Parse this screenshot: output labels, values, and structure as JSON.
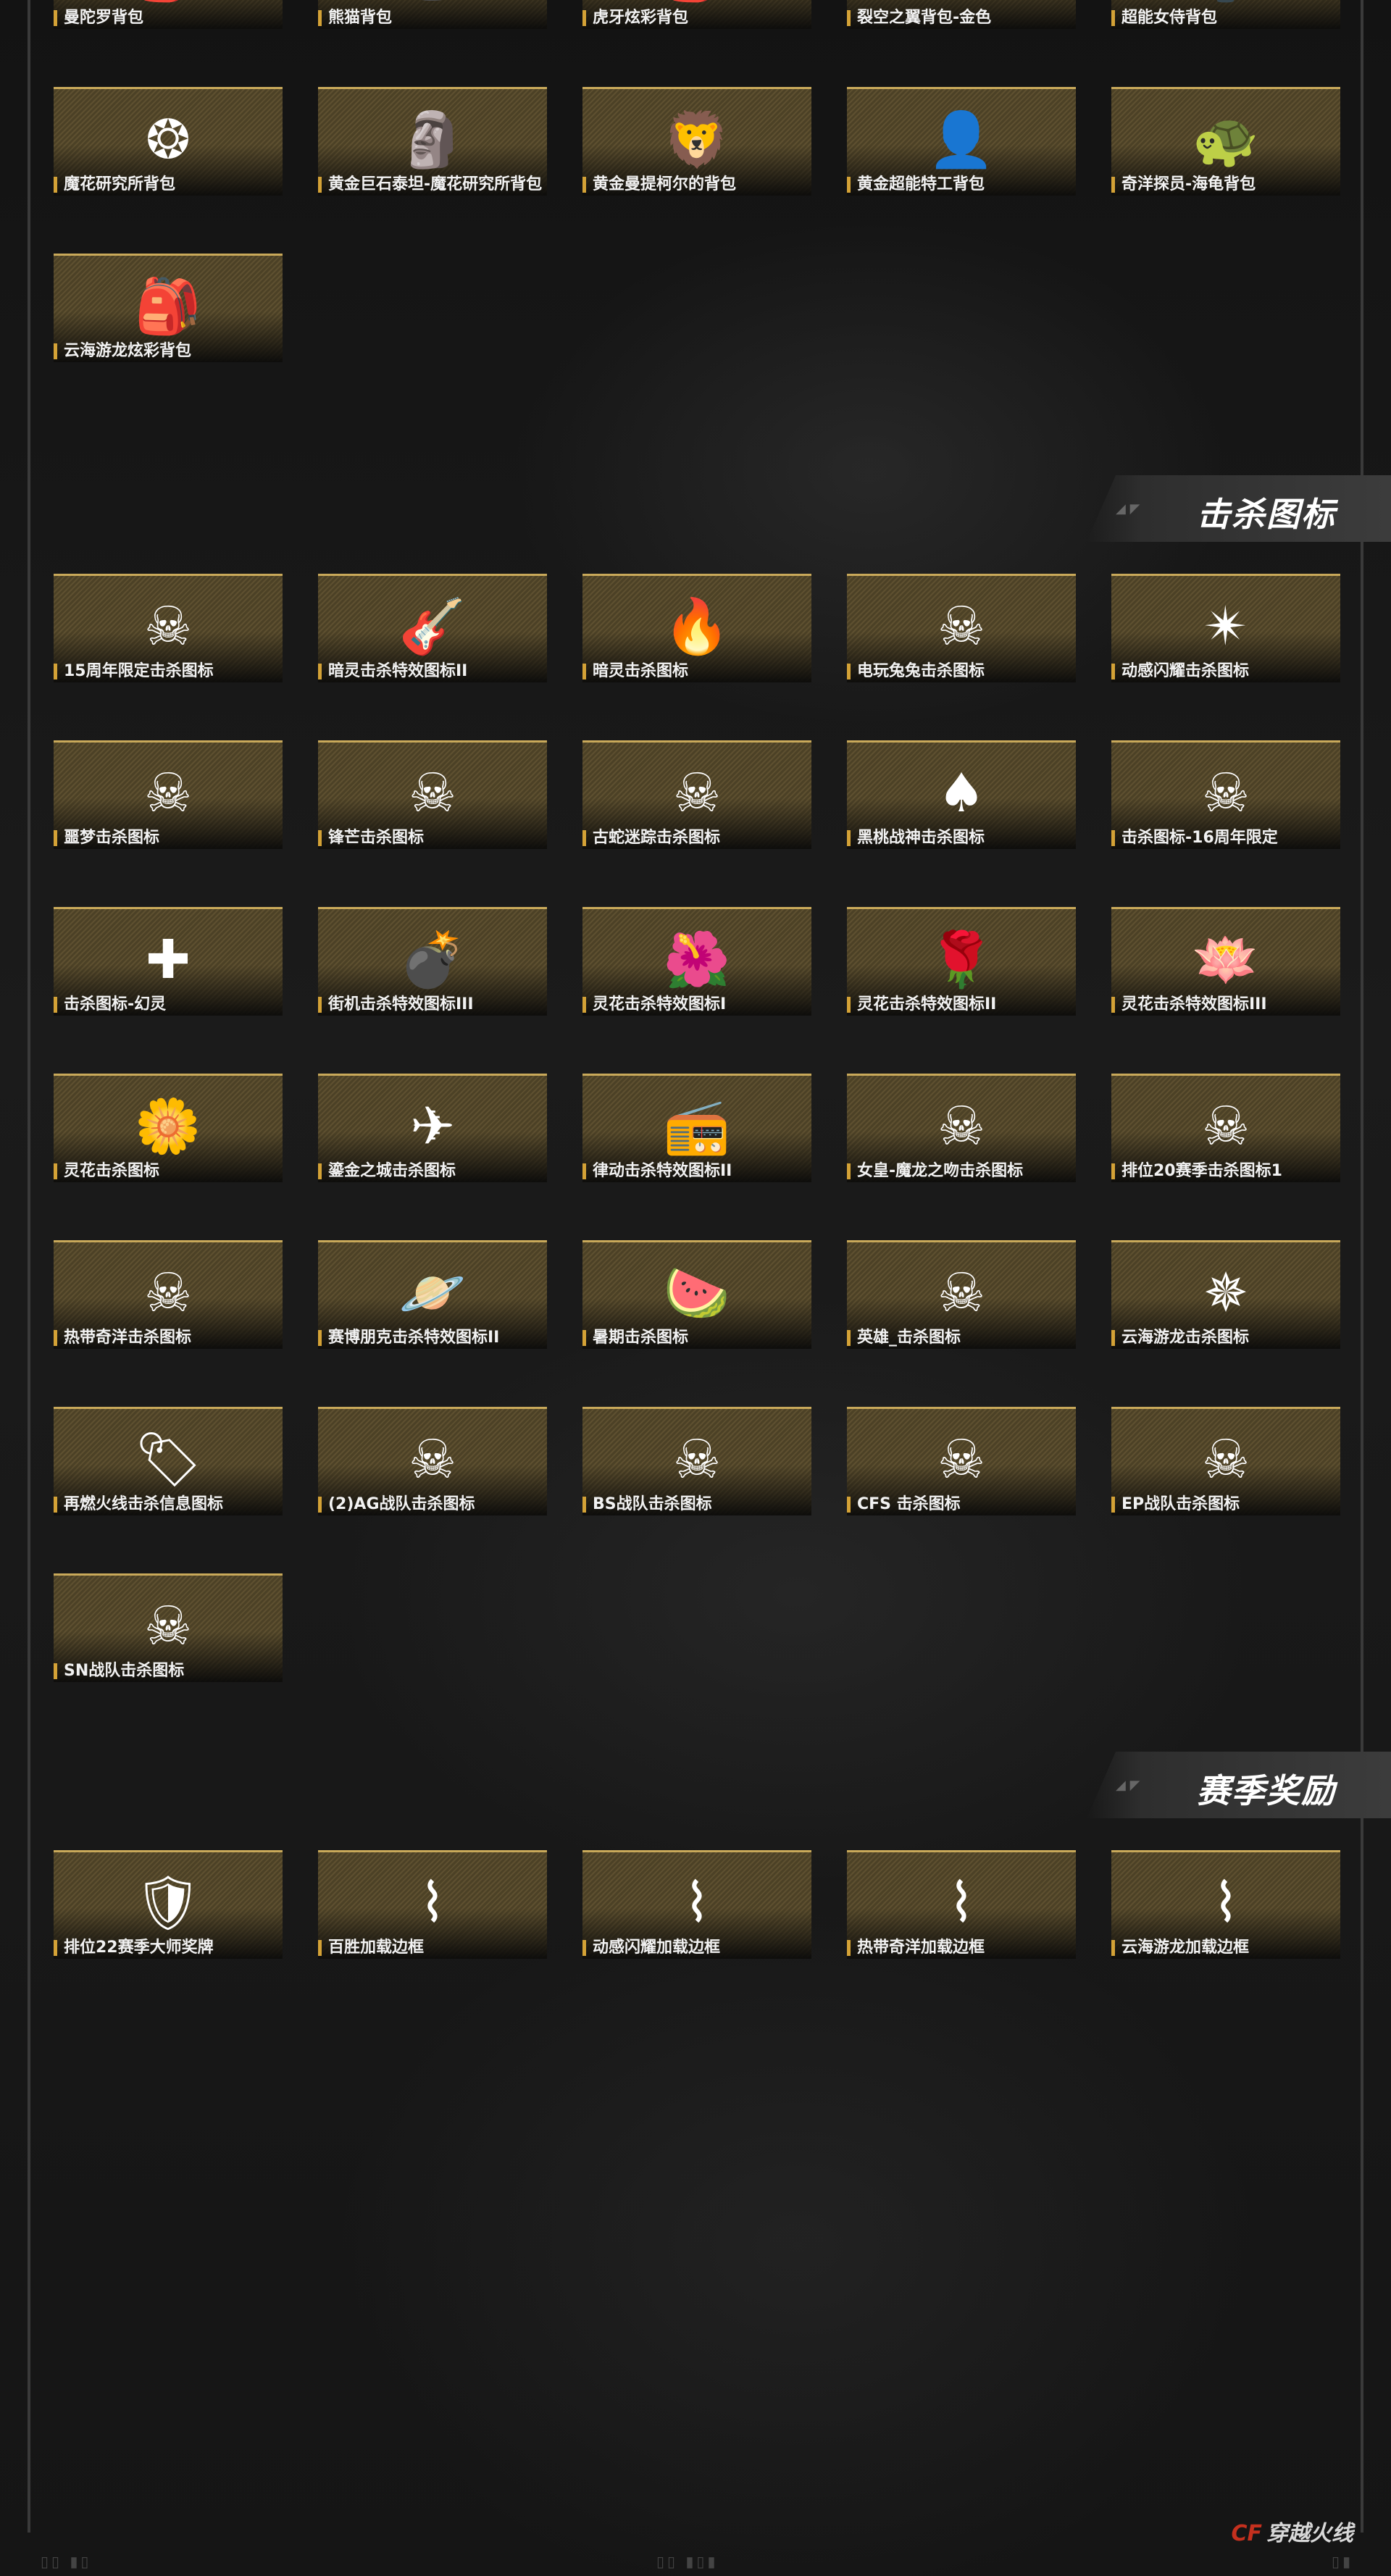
{
  "sections": {
    "kill_icons": "击杀图标",
    "season_rewards": "赛季奖励"
  },
  "backpacks": [
    {
      "label": "曼陀罗背包",
      "icon": "girl-backpack-icon",
      "glyph": "🎒"
    },
    {
      "label": "熊猫背包",
      "icon": "panda-backpack-icon",
      "glyph": "🐼"
    },
    {
      "label": "虎牙炫彩背包",
      "icon": "tiger-backpack-icon",
      "glyph": "🎒"
    },
    {
      "label": "裂空之翼背包-金色",
      "icon": "golden-wing-backpack-icon",
      "glyph": "✴"
    },
    {
      "label": "超能女侍背包",
      "icon": "maid-backpack-icon",
      "glyph": "🏮"
    },
    {
      "label": "魔花研究所背包",
      "icon": "ring-backpack-icon",
      "glyph": "❂"
    },
    {
      "label": "黄金巨石泰坦-魔花研究所背包",
      "icon": "golden-titan-icon",
      "glyph": "🗿"
    },
    {
      "label": "黄金曼提柯尔的背包",
      "icon": "golden-manticore-icon",
      "glyph": "🦁"
    },
    {
      "label": "黄金超能特工背包",
      "icon": "golden-agent-icon",
      "glyph": "👤"
    },
    {
      "label": "奇洋探员-海龟背包",
      "icon": "turtle-backpack-icon",
      "glyph": "🐢"
    },
    {
      "label": "云海游龙炫彩背包",
      "icon": "dragon-backpack-icon",
      "glyph": "🎒"
    }
  ],
  "kill_icons": [
    {
      "label": "15周年限定击杀图标",
      "icon": "skull-compass-icon",
      "glyph": "☠"
    },
    {
      "label": "暗灵击杀特效图标II",
      "icon": "guitar-icon",
      "glyph": "🎸"
    },
    {
      "label": "暗灵击杀图标",
      "icon": "purple-flame-icon",
      "glyph": "🔥"
    },
    {
      "label": "电玩兔兔击杀图标",
      "icon": "bunny-skull-icon",
      "glyph": "☠"
    },
    {
      "label": "动感闪耀击杀图标",
      "icon": "rainbow-star-icon",
      "glyph": "✴"
    },
    {
      "label": "噩梦击杀图标",
      "icon": "nightmare-skull-icon",
      "glyph": "☠"
    },
    {
      "label": "锋芒击杀图标",
      "icon": "winged-skull-icon",
      "glyph": "☠"
    },
    {
      "label": "古蛇迷踪击杀图标",
      "icon": "snake-skull-icon",
      "glyph": "☠"
    },
    {
      "label": "黑桃战神击杀图标",
      "icon": "spade-skull-icon",
      "glyph": "♠"
    },
    {
      "label": "击杀图标-16周年限定",
      "icon": "purple-skull-icon",
      "glyph": "☠"
    },
    {
      "label": "击杀图标-幻灵",
      "icon": "blue-cross-icon",
      "glyph": "✚"
    },
    {
      "label": "街机击杀特效图标III",
      "icon": "bomb-icon",
      "glyph": "💣"
    },
    {
      "label": "灵花击杀特效图标I",
      "icon": "red-lotus-icon",
      "glyph": "🌺"
    },
    {
      "label": "灵花击杀特效图标II",
      "icon": "rose-icon",
      "glyph": "🌹"
    },
    {
      "label": "灵花击杀特效图标III",
      "icon": "green-lotus-icon",
      "glyph": "🪷"
    },
    {
      "label": "灵花击杀图标",
      "icon": "flower-spirit-icon",
      "glyph": "🌼"
    },
    {
      "label": "鎏金之城击杀图标",
      "icon": "cf-logo-icon",
      "glyph": "✈"
    },
    {
      "label": "律动击杀特效图标II",
      "icon": "boombox-icon",
      "glyph": "📻"
    },
    {
      "label": "女皇-魔龙之吻击杀图标",
      "icon": "dragon-kiss-icon",
      "glyph": "☠"
    },
    {
      "label": "排位20赛季击杀图标1",
      "icon": "rank-skull-icon",
      "glyph": "☠"
    },
    {
      "label": "热带奇洋击杀图标",
      "icon": "tropical-skull-icon",
      "glyph": "☠"
    },
    {
      "label": "赛博朋克击杀特效图标II",
      "icon": "planet-icon",
      "glyph": "🪐"
    },
    {
      "label": "暑期击杀图标",
      "icon": "watermelon-icon",
      "glyph": "🍉"
    },
    {
      "label": "英雄_击杀图标",
      "icon": "hero-skull-icon",
      "glyph": "☠"
    },
    {
      "label": "云海游龙击杀图标",
      "icon": "dragon-star-icon",
      "glyph": "✵"
    },
    {
      "label": "再燃火线击杀信息图标",
      "icon": "dog-tag-icon",
      "glyph": "🏷"
    },
    {
      "label": "(2)AG战队击杀图标",
      "icon": "ag-skull-icon",
      "glyph": "☠"
    },
    {
      "label": "BS战队击杀图标",
      "icon": "bs-skull-icon",
      "glyph": "☠"
    },
    {
      "label": "CFS 击杀图标",
      "icon": "cfs-skull-icon",
      "glyph": "☠"
    },
    {
      "label": "EP战队击杀图标",
      "icon": "ep-skull-icon",
      "glyph": "☠"
    },
    {
      "label": "SN战队击杀图标",
      "icon": "sn-skull-icon",
      "glyph": "☠"
    }
  ],
  "season_rewards": [
    {
      "label": "排位22赛季大师奖牌",
      "icon": "master-medal-icon",
      "glyph": "🛡"
    },
    {
      "label": "百胜加载边框",
      "icon": "gold-frame-icon",
      "glyph": "⌇"
    },
    {
      "label": "动感闪耀加载边框",
      "icon": "neon-frame-icon",
      "glyph": "⌇"
    },
    {
      "label": "热带奇洋加载边框",
      "icon": "tropical-frame-icon",
      "glyph": "⌇"
    },
    {
      "label": "云海游龙加载边框",
      "icon": "dragon-frame-icon",
      "glyph": "⌇"
    }
  ],
  "footer": {
    "logo_mark": "CF",
    "logo_text": "穿越火线"
  },
  "colors": {
    "accent": "#d4a236",
    "tile_border": "#c9a95a"
  }
}
